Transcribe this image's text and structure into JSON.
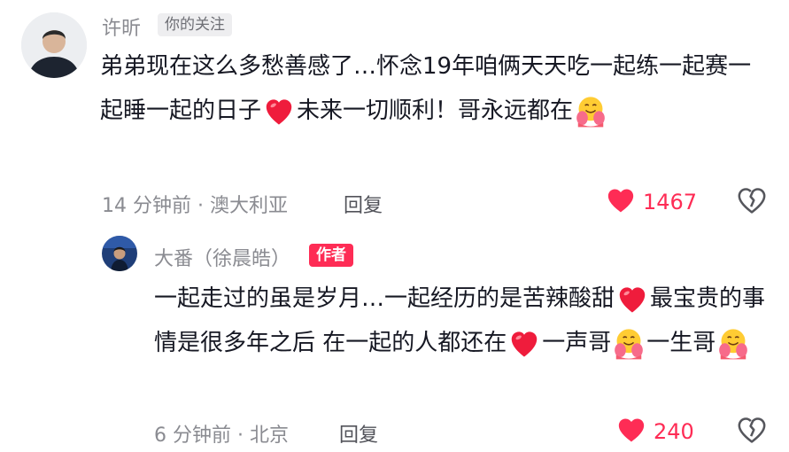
{
  "comment": {
    "author": "许昕",
    "follow_badge": "你的关注",
    "text_parts": [
      "弟弟现在这么多愁善感了…怀念19年咱俩天天吃一起练一起赛一起睡一起的日子",
      "未来一切顺利！哥永远都在"
    ],
    "time_location": "14 分钟前 · 澳大利亚",
    "reply_label": "回复",
    "likes": "1467"
  },
  "reply": {
    "author": "大番（徐晨皓）",
    "author_badge": "作者",
    "text_parts": [
      "一起走过的虽是岁月…一起经历的是苦辣酸甜",
      "最宝贵的事情是很多年之后 在一起的人都还在",
      "一声哥",
      "一生哥"
    ],
    "time_location": "6 分钟前 · 北京",
    "reply_label": "回复",
    "likes": "240"
  },
  "icons": {
    "heart_emoji": "red-heart-icon",
    "hug_emoji": "hugging-face-icon",
    "like": "heart-icon",
    "dislike": "broken-heart-icon"
  },
  "colors": {
    "accent": "#fe2c55",
    "muted_text": "#8a8b91",
    "body_text": "#161823"
  }
}
